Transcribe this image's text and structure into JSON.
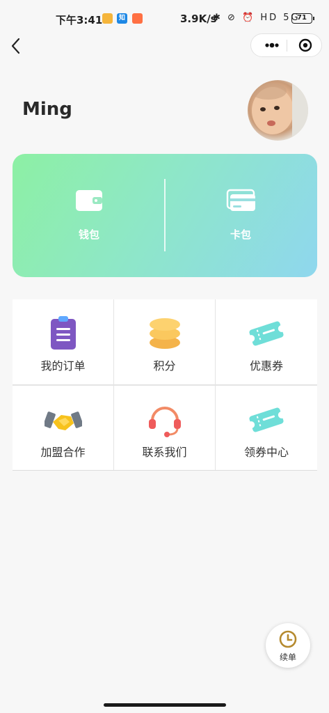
{
  "status_bar": {
    "time": "下午3:41",
    "app_badge_2": "知",
    "net_speed": "3.9K/s",
    "icons": "✱ ⊘ ⏰ HD 5G",
    "battery": "71"
  },
  "profile": {
    "username": "Ming"
  },
  "card": {
    "wallet_label": "钱包",
    "cards_label": "卡包",
    "gradient_colors": [
      "#8df0a4",
      "#8fd7ee"
    ]
  },
  "menu": [
    {
      "label": "我的订单",
      "icon": "clipboard-icon"
    },
    {
      "label": "积分",
      "icon": "coins-icon"
    },
    {
      "label": "优惠券",
      "icon": "ticket-icon"
    },
    {
      "label": "加盟合作",
      "icon": "handshake-icon"
    },
    {
      "label": "联系我们",
      "icon": "headset-icon"
    },
    {
      "label": "领券中心",
      "icon": "ticket-center-icon"
    }
  ],
  "float_button": {
    "label": "续单",
    "icon": "clock-icon",
    "accent": "#b58a2e"
  }
}
